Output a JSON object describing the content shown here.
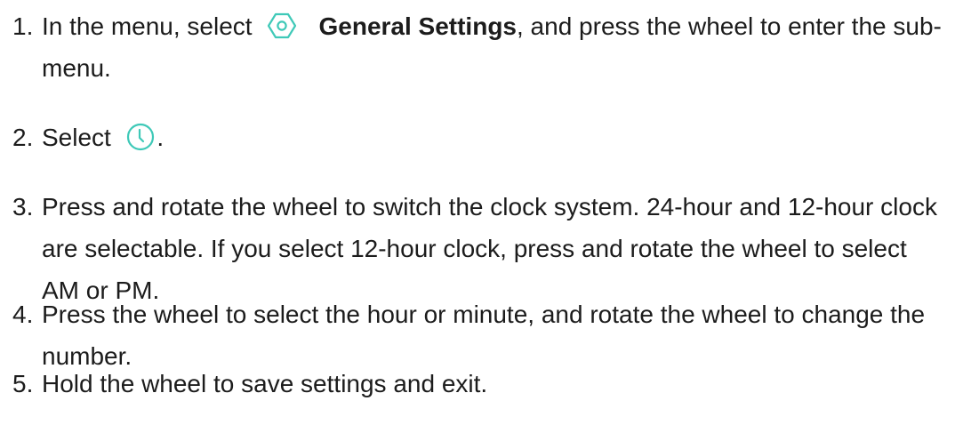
{
  "steps": [
    {
      "number": "1.",
      "text_before": "In the menu, select",
      "icon": "general-settings-hexagon-icon",
      "bold": "General Settings",
      "text_after": ", and press the wheel to enter the sub-menu."
    },
    {
      "number": "2.",
      "text_before": "Select",
      "icon": "clock-icon",
      "text_after": "."
    },
    {
      "number": "3.",
      "text": "Press and rotate the wheel to switch the clock system. 24-hour and 12-hour clock are selectable. If you select 12-hour clock, press and rotate the wheel to select AM or PM."
    },
    {
      "number": "4.",
      "text": "Press the wheel to select the hour or minute, and rotate the wheel to change the number."
    },
    {
      "number": "5.",
      "text": "Hold the wheel to save settings and exit."
    }
  ],
  "colors": {
    "icon_accent": "#3fc9b8",
    "text": "#1c1c1c"
  }
}
